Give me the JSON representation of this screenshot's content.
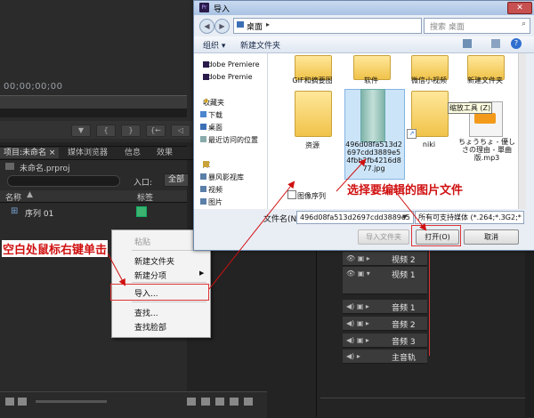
{
  "premiere": {
    "timecode": "00;00;00;00",
    "transport_buttons": [
      "▼",
      "{",
      "}",
      "{←",
      "◁"
    ],
    "tabs": [
      "项目:未命名 ×",
      "媒体浏览器",
      "信息",
      "效果"
    ],
    "project_file": "未命名.prproj",
    "entry_label": "入口:",
    "entry_value": "全部",
    "column_name": "名称",
    "column_label": "标签",
    "sequence_name": "序列 01",
    "label_color": "#3cb371"
  },
  "context_menu": {
    "items": [
      {
        "label": "粘贴",
        "disabled": true
      },
      {
        "label": "新建文件夹",
        "disabled": false
      },
      {
        "label": "新建分项",
        "disabled": false,
        "submenu": true
      },
      {
        "label": "导入...",
        "disabled": false,
        "highlighted": true
      },
      {
        "label": "查找...",
        "disabled": false
      },
      {
        "label": "查找脸部",
        "disabled": false
      }
    ]
  },
  "timeline": {
    "tracks": [
      {
        "label": "视频 2",
        "type": "video"
      },
      {
        "label": "视频 1",
        "type": "video"
      },
      {
        "label": "音频 1",
        "type": "audio"
      },
      {
        "label": "音频 2",
        "type": "audio"
      },
      {
        "label": "音频 3",
        "type": "audio"
      },
      {
        "label": "主音轨",
        "type": "master"
      }
    ],
    "playhead_color": "#dd3333"
  },
  "dialog": {
    "title": "导入",
    "close_label": "✕",
    "path": "桌面",
    "path_arrow": "▸",
    "search_placeholder": "搜索 桌面",
    "toolbar": {
      "organize": "组织 ▾",
      "new_folder": "新建文件夹"
    },
    "nav_items": [
      {
        "label": "Adobe Premiere",
        "icon": "premiere-icon"
      },
      {
        "label": "Adobe Premie",
        "icon": "premiere-icon"
      },
      {
        "label": "收藏夹",
        "icon": "star-icon"
      },
      {
        "label": "下载",
        "icon": "download-folder-icon"
      },
      {
        "label": "桌面",
        "icon": "desktop-icon"
      },
      {
        "label": "最近访问的位置",
        "icon": "recent-icon"
      },
      {
        "label": "库",
        "icon": "library-icon"
      },
      {
        "label": "暴风影视库",
        "icon": "media-library-icon"
      },
      {
        "label": "视频",
        "icon": "video-library-icon"
      },
      {
        "label": "图片",
        "icon": "picture-library-icon"
      }
    ],
    "files": [
      {
        "name": "GIF和摘要图",
        "type": "folder"
      },
      {
        "name": "软件",
        "type": "folder"
      },
      {
        "name": "微信小视频",
        "type": "folder"
      },
      {
        "name": "新建文件夹",
        "type": "folder"
      },
      {
        "name": "资源",
        "type": "folder"
      },
      {
        "name": "496d08fa513d2697cdd3889e54fbb2fb4216d877.jpg",
        "type": "image",
        "selected": true
      },
      {
        "name": "niki",
        "type": "folder"
      },
      {
        "name": "ちょうちょ - 優しさの理由 - 單曲版.mp3",
        "type": "audio"
      }
    ],
    "tooltip": "缩放工具 (Z)",
    "sequence_checkbox": "图像序列",
    "filename_label": "文件名(N):",
    "filename_value": "496d08fa513d2697cdd3889e5",
    "filetype_value": "所有可支持媒体 (*.264;*.3G2;*",
    "buttons": {
      "import_folder": "导入文件夹",
      "open": "打开(O)",
      "cancel": "取消"
    }
  },
  "annotations": {
    "right_click": "空白处鼠标右键单击",
    "select_image": "选择要编辑的图片文件",
    "color": "#d01010"
  }
}
